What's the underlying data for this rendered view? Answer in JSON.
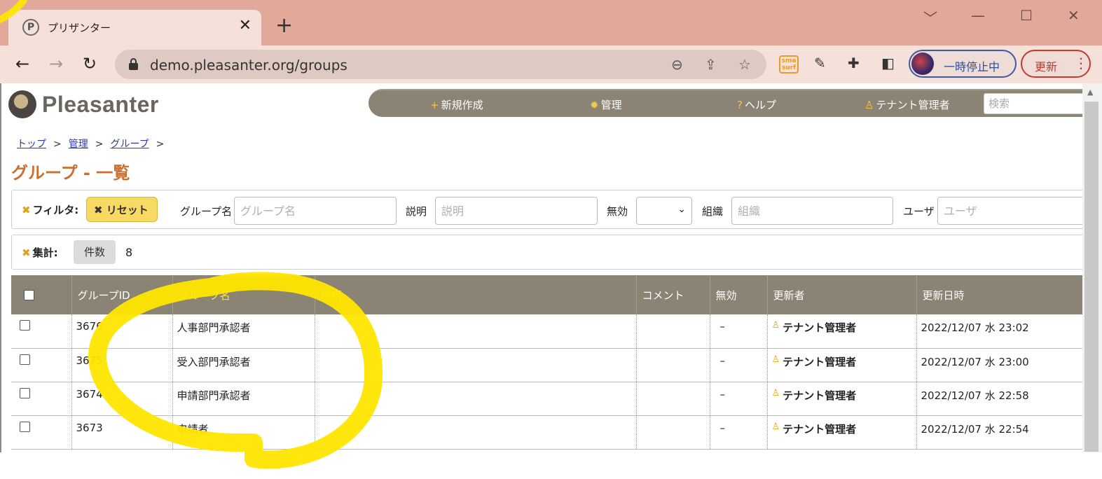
{
  "browser": {
    "tab_title": "プリザンター",
    "tab_favicon_letter": "P",
    "close_glyph": "✕",
    "new_tab_glyph": "+",
    "window_controls": [
      "﹀",
      "—",
      "☐",
      "✕"
    ],
    "back_glyph": "←",
    "forward_glyph": "→",
    "reload_glyph": "↻",
    "url": "demo.pleasanter.org/groups",
    "omnibox_icons": [
      "zoom-out-icon",
      "share-icon",
      "star-icon"
    ],
    "smasurf_label": "sma surf",
    "profile_status": "一時停止中",
    "update_label": "更新",
    "menu_glyph": "⋮"
  },
  "app": {
    "logo_text": "Pleasanter",
    "nav": {
      "new": "新規作成",
      "manage": "管理",
      "help": "ヘルプ",
      "tenant_admin": "テナント管理者",
      "search_placeholder": "検索"
    },
    "breadcrumb": [
      "トップ",
      "管理",
      "グループ"
    ],
    "breadcrumb_sep": ">",
    "page_title": "グループ - 一覧"
  },
  "filter": {
    "label": "フィルタ:",
    "reset_label": "リセット",
    "fields": [
      {
        "label": "グループ名",
        "placeholder": "グループ名"
      },
      {
        "label": "説明",
        "placeholder": "説明"
      },
      {
        "label": "無効",
        "value": ""
      },
      {
        "label": "組織",
        "placeholder": "組織"
      },
      {
        "label": "ユーザ",
        "placeholder": "ユーザ"
      }
    ]
  },
  "aggregate": {
    "label": "集計:",
    "type": "件数",
    "value": "8"
  },
  "table": {
    "columns": [
      "グループID",
      "グループ名",
      "説明",
      "コメント",
      "無効",
      "更新者",
      "更新日時"
    ],
    "rows": [
      {
        "id": "3676",
        "name": "人事部門承認者",
        "desc": "",
        "comment": "",
        "disabled": "–",
        "updater": "テナント管理者",
        "updated": "2022/12/07 水 23:02"
      },
      {
        "id": "3675",
        "name": "受入部門承認者",
        "desc": "",
        "comment": "",
        "disabled": "–",
        "updater": "テナント管理者",
        "updated": "2022/12/07 水 23:00"
      },
      {
        "id": "3674",
        "name": "申請部門承認者",
        "desc": "",
        "comment": "",
        "disabled": "–",
        "updater": "テナント管理者",
        "updated": "2022/12/07 水 22:58"
      },
      {
        "id": "3673",
        "name": "申請者",
        "desc": "",
        "comment": "",
        "disabled": "–",
        "updater": "テナント管理者",
        "updated": "2022/12/07 水 22:54"
      }
    ]
  },
  "colors": {
    "highlight": "#ffe600",
    "nav_bg": "#8b8373",
    "title": "#c9702e"
  }
}
